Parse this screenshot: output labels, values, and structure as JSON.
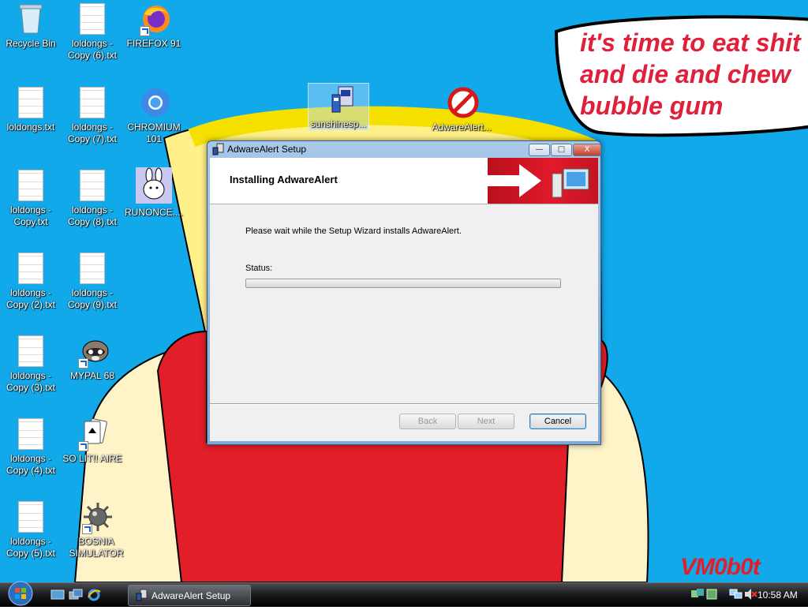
{
  "speech_bubble": {
    "text": "it's time to eat shit and die and chew bubble gum"
  },
  "signature": "VM0b0t",
  "desktop_icons": [
    {
      "label": "Recycle Bin"
    },
    {
      "label": "loldongs - Copy (6).txt"
    },
    {
      "label": "FIREFOX 91"
    },
    {
      "label": "loldongs.txt"
    },
    {
      "label": "loldongs - Copy (7).txt"
    },
    {
      "label": "CHROMIUM 101"
    },
    {
      "label": "loldongs - Copy.txt"
    },
    {
      "label": "loldongs - Copy (8).txt"
    },
    {
      "label": "RUNONCE...."
    },
    {
      "label": "loldongs - Copy (2).txt"
    },
    {
      "label": "loldongs - Copy (9).txt"
    },
    {
      "label": "loldongs - Copy (3).txt"
    },
    {
      "label": "MYPAL 68"
    },
    {
      "label": "loldongs - Copy (4).txt"
    },
    {
      "label": "SO LIT!! AIRE"
    },
    {
      "label": "loldongs - Copy (5).txt"
    },
    {
      "label": "BOSNIA SIMULATOR"
    },
    {
      "label": "sunshinesp..."
    },
    {
      "label": "AdwareAlert..."
    }
  ],
  "dialog": {
    "title": "AdwareAlert Setup",
    "heading": "Installing AdwareAlert",
    "body": "Please wait while the Setup Wizard installs AdwareAlert.",
    "status_label": "Status:",
    "progress": 0,
    "buttons": {
      "back": "Back",
      "next": "Next",
      "cancel": "Cancel"
    },
    "window_buttons": {
      "minimize": "—",
      "maximize": "□",
      "close": "X"
    }
  },
  "taskbar": {
    "task_label": "AdwareAlert Setup",
    "clock": "10:58 AM"
  },
  "colors": {
    "desktop_bg": "#12a9ea",
    "accent_red": "#e2192b"
  }
}
